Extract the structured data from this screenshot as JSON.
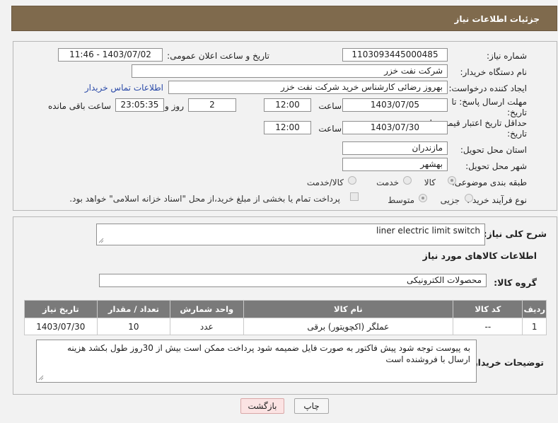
{
  "header": {
    "title": "جزئیات اطلاعات نیاز"
  },
  "form": {
    "need_number_label": "شماره نیاز:",
    "need_number": "1103093445000485",
    "announce_label": "تاریخ و ساعت اعلان عمومی:",
    "announce_value": "1403/07/02 - 11:46",
    "buyer_org_label": "نام دستگاه خریدار:",
    "buyer_org": "شرکت نفت خزر",
    "creator_label": "ایجاد کننده درخواست:",
    "creator": "بهروز رضائی کارشناس خرید شرکت نفت خزر",
    "contact_link": "اطلاعات تماس خریدار",
    "deadline_label_1": "مهلت ارسال پاسخ: تا",
    "deadline_label_2": "تاریخ:",
    "deadline_date": "1403/07/05",
    "time_label": "ساعت",
    "deadline_time": "12:00",
    "days_value": "2",
    "days_label": "روز و",
    "remaining_time": "23:05:35",
    "remaining_label": "ساعت باقی مانده",
    "validity_label_1": "حداقل تاریخ اعتبار قیمت: تا",
    "validity_label_2": "تاریخ:",
    "validity_date": "1403/07/30",
    "validity_time_label": "ساعت",
    "validity_time": "12:00",
    "province_label": "استان محل تحویل:",
    "province": "مازندران",
    "city_label": "شهر محل تحویل:",
    "city": "بهشهر",
    "category_label": "طبقه بندی موضوعی:",
    "category_options": [
      "کالا",
      "خدمت",
      "کالا/خدمت"
    ],
    "process_label": "نوع فرآیند خرید :",
    "process_options": [
      "جزیی",
      "متوسط"
    ],
    "payment_note": "پرداخت تمام یا بخشی از مبلغ خرید،از محل \"اسناد خزانه اسلامی\" خواهد بود."
  },
  "need": {
    "summary_label": "شرح کلی نیاز:",
    "summary": "liner electric limit switch",
    "goods_info_title": "اطلاعات کالاهای مورد نیاز",
    "goods_group_label": "گروه کالا:",
    "goods_group": "محصولات الکترونیکی"
  },
  "table": {
    "columns": [
      "ردیف",
      "کد کالا",
      "نام کالا",
      "واحد شمارش",
      "تعداد / مقدار",
      "تاریخ نیاز"
    ],
    "rows": [
      [
        "1",
        "--",
        "عملگر (اکچویتور) برقی",
        "عدد",
        "10",
        "1403/07/30"
      ]
    ]
  },
  "buyer_notes": {
    "label": "توضیحات خریدار:",
    "text": "به پیوست توجه شود پیش فاکتور به صورت فایل ضمیمه شود پرداخت ممکن است بیش از 30روز طول بکشد هزینه ارسال با فروشنده است"
  },
  "buttons": {
    "print": "چاپ",
    "back": "بازگشت"
  },
  "colors": {
    "header": "#7f6a4d",
    "table_header": "#7a7a7a",
    "link": "#2a4aa8"
  }
}
